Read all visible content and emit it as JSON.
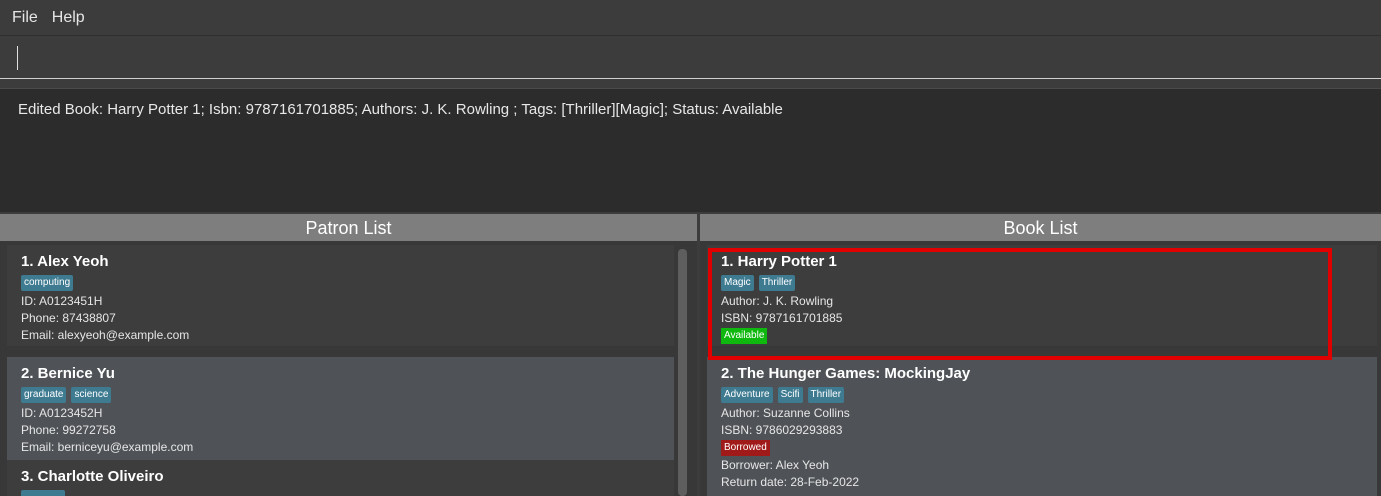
{
  "menu": {
    "file": "File",
    "help": "Help"
  },
  "command": {
    "value": "",
    "placeholder": ""
  },
  "result": {
    "text": "Edited Book: Harry Potter 1; Isbn: 9787161701885; Authors: J. K. Rowling ; Tags: [Thriller][Magic]; Status: Available"
  },
  "patron_list": {
    "title": "Patron List",
    "patrons": [
      {
        "index_name": "1.  Alex Yeoh",
        "tags": [
          "computing"
        ],
        "id": "ID: A0123451H",
        "phone": "Phone: 87438807",
        "email": "Email: alexyeoh@example.com"
      },
      {
        "index_name": "2.  Bernice Yu",
        "tags": [
          "graduate",
          "science"
        ],
        "id": "ID: A0123452H",
        "phone": "Phone: 99272758",
        "email": "Email: berniceyu@example.com"
      },
      {
        "index_name": "3.  Charlotte Oliveiro",
        "tags": [],
        "id": "",
        "phone": "",
        "email": ""
      }
    ]
  },
  "book_list": {
    "title": "Book List",
    "books": [
      {
        "index_name": "1.  Harry Potter 1",
        "tags": [
          "Magic",
          "Thriller"
        ],
        "author": "Author: J. K. Rowling",
        "isbn": "ISBN: 9787161701885",
        "status": "Available"
      },
      {
        "index_name": "2.  The Hunger Games: MockingJay",
        "tags": [
          "Adventure",
          "Scifi",
          "Thriller"
        ],
        "author": "Author: Suzanne Collins",
        "isbn": "ISBN: 9786029293883",
        "status": "Borrowed",
        "borrower": "Borrower: Alex Yeoh",
        "return_date": "Return date: 28-Feb-2022"
      }
    ]
  },
  "colors": {
    "tag": "#3e7b91",
    "available": "#0fb80f",
    "borrowed": "#a11a1a",
    "highlight": "#e00000"
  }
}
